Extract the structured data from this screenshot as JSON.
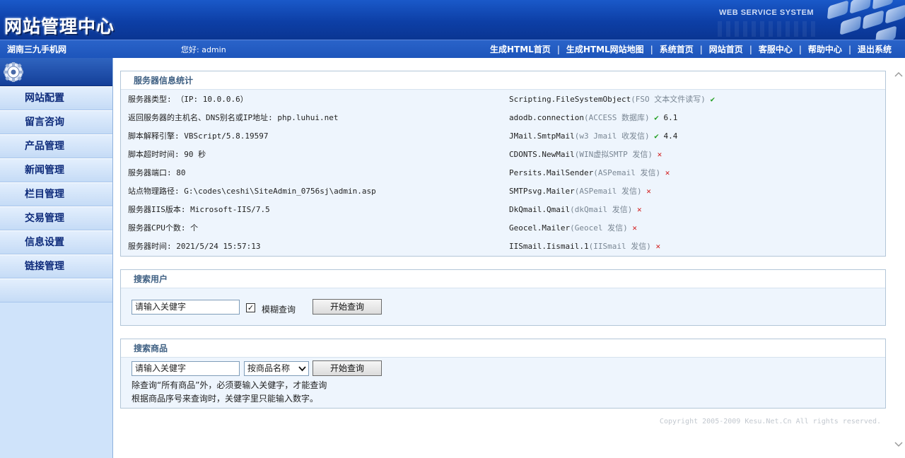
{
  "header": {
    "logo_text": "网站管理中心",
    "tagline": "WEB SERVICE SYSTEM"
  },
  "navbar": {
    "site_name": "湖南三九手机网",
    "greeting": "您好: admin",
    "links": [
      "生成HTML首页",
      "生成HTML网站地图",
      "系统首页",
      "网站首页",
      "客服中心",
      "帮助中心",
      "退出系统"
    ]
  },
  "sidebar": {
    "items": [
      "网站配置",
      "留言咨询",
      "产品管理",
      "新闻管理",
      "栏目管理",
      "交易管理",
      "信息设置",
      "链接管理"
    ]
  },
  "server_info": {
    "title": "服务器信息统计",
    "left": [
      "服务器类型: （IP: 10.0.0.6）",
      "返回服务器的主机名、DNS别名或IP地址: php.luhui.net",
      "脚本解释引擎: VBScript/5.8.19597",
      "脚本超时时间: 90 秒",
      "服务器端口: 80",
      "站点物理路径: G:\\codes\\ceshi\\SiteAdmin_0756sj\\admin.asp",
      "服务器IIS版本: Microsoft-IIS/7.5",
      "服务器CPU个数:  个",
      "服务器时间: 2021/5/24 15:57:13"
    ],
    "components": [
      {
        "name": "Scripting.FileSystemObject",
        "desc": "(FSO 文本文件读写)",
        "mark": "✔",
        "status": "ok",
        "version": ""
      },
      {
        "name": "adodb.connection",
        "desc": "(ACCESS 数据库)",
        "mark": "✔",
        "status": "ok",
        "version": "6.1"
      },
      {
        "name": "JMail.SmtpMail",
        "desc": "(w3 Jmail 收发信)",
        "mark": "✔",
        "status": "ok",
        "version": "4.4"
      },
      {
        "name": "CDONTS.NewMail",
        "desc": "(WIN虚拟SMTP 发信)",
        "mark": "✕",
        "status": "bad",
        "version": ""
      },
      {
        "name": "Persits.MailSender",
        "desc": "(ASPemail 发信)",
        "mark": "✕",
        "status": "bad",
        "version": ""
      },
      {
        "name": "SMTPsvg.Mailer",
        "desc": "(ASPemail 发信)",
        "mark": "✕",
        "status": "bad",
        "version": ""
      },
      {
        "name": "DkQmail.Qmail",
        "desc": "(dkQmail 发信)",
        "mark": "✕",
        "status": "bad",
        "version": ""
      },
      {
        "name": "Geocel.Mailer",
        "desc": "(Geocel 发信)",
        "mark": "✕",
        "status": "bad",
        "version": ""
      },
      {
        "name": "IISmail.Iismail.1",
        "desc": "(IISmail 发信)",
        "mark": "✕",
        "status": "bad",
        "version": ""
      }
    ]
  },
  "search_user": {
    "title": "搜索用户",
    "input_value": "请输入关健字",
    "fuzzy_label": "模糊查询",
    "fuzzy_mark": "✓",
    "button": "开始查询"
  },
  "search_goods": {
    "title": "搜索商品",
    "input_value": "请输入关健字",
    "select_value": "按商品名称",
    "button": "开始查询",
    "notes": [
      "除查询“所有商品”外，必须要输入关健字，才能查询",
      "根据商品序号来查询时，关健字里只能输入数字。"
    ]
  },
  "copyright": "Copyright 2005-2009 Kesu.Net.Cn All rights reserved.",
  "colors": {
    "header_blue": "#0d3fa6",
    "nav_blue": "#1d55bb",
    "sidebar_bg": "#cfe3fa",
    "menu_text": "#0d2a7a",
    "ok_green": "#23a023",
    "error_red": "#d21a1a"
  }
}
